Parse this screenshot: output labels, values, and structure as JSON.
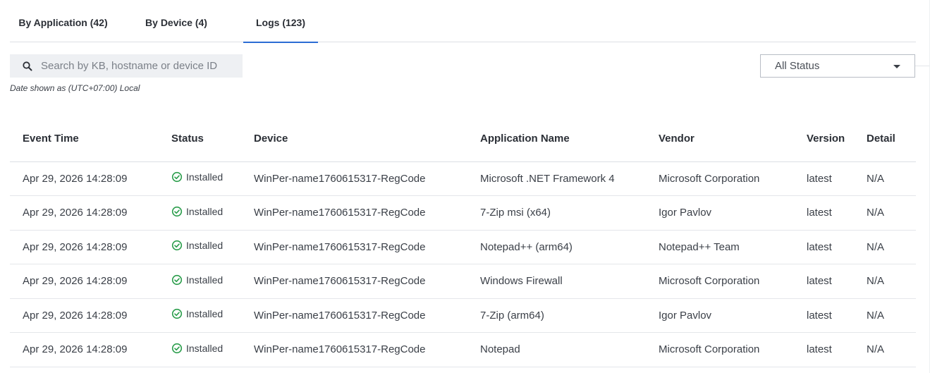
{
  "tabs": [
    {
      "label": "By Application (42)"
    },
    {
      "label": "By Device (4)"
    },
    {
      "label": "Logs (123)"
    }
  ],
  "active_tab": 2,
  "search": {
    "placeholder": "Search by KB, hostname or device ID",
    "value": "",
    "icon": "search-icon"
  },
  "date_note": "Date shown as (UTC+07:00) Local",
  "status_filter": {
    "selected": "All Status",
    "icon": "chevron-down-icon"
  },
  "colors": {
    "accent": "#2b6cd4",
    "success": "#2a9d4b"
  },
  "table": {
    "columns": [
      "Event Time",
      "Status",
      "Device",
      "Application Name",
      "Vendor",
      "Version",
      "Detail"
    ],
    "rows": [
      {
        "time": "Apr 29, 2026 14:28:09",
        "status": "Installed",
        "device": "WinPer-name1760615317-RegCode",
        "app": "Microsoft .NET Framework 4",
        "vendor": "Microsoft Corporation",
        "version": "latest",
        "detail": "N/A"
      },
      {
        "time": "Apr 29, 2026 14:28:09",
        "status": "Installed",
        "device": "WinPer-name1760615317-RegCode",
        "app": "7-Zip msi (x64)",
        "vendor": "Igor Pavlov",
        "version": "latest",
        "detail": "N/A"
      },
      {
        "time": "Apr 29, 2026 14:28:09",
        "status": "Installed",
        "device": "WinPer-name1760615317-RegCode",
        "app": "Notepad++ (arm64)",
        "vendor": "Notepad++ Team",
        "version": "latest",
        "detail": "N/A"
      },
      {
        "time": "Apr 29, 2026 14:28:09",
        "status": "Installed",
        "device": "WinPer-name1760615317-RegCode",
        "app": "Windows Firewall",
        "vendor": "Microsoft Corporation",
        "version": "latest",
        "detail": "N/A"
      },
      {
        "time": "Apr 29, 2026 14:28:09",
        "status": "Installed",
        "device": "WinPer-name1760615317-RegCode",
        "app": "7-Zip (arm64)",
        "vendor": "Igor Pavlov",
        "version": "latest",
        "detail": "N/A"
      },
      {
        "time": "Apr 29, 2026 14:28:09",
        "status": "Installed",
        "device": "WinPer-name1760615317-RegCode",
        "app": "Notepad",
        "vendor": "Microsoft Corporation",
        "version": "latest",
        "detail": "N/A"
      }
    ]
  }
}
